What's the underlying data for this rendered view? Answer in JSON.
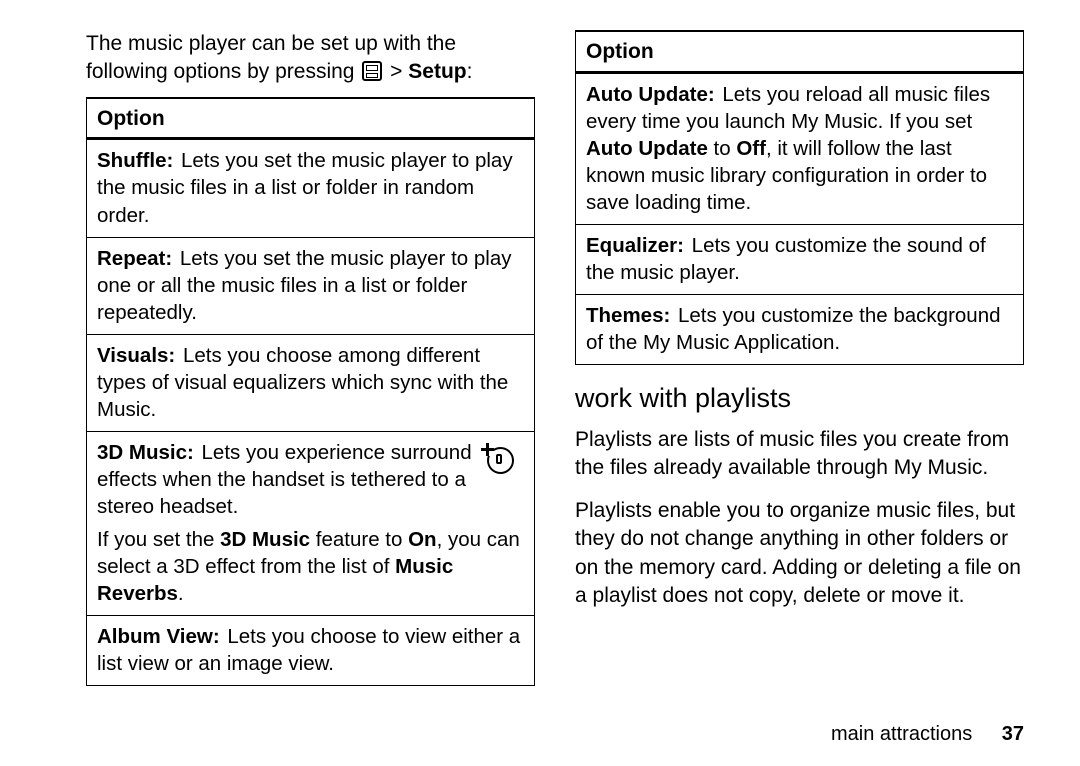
{
  "intro": {
    "line1": "The music player can be set up with the",
    "line2a": "following options by pressing ",
    "line2b": " > ",
    "setup": "Setup",
    "line2c": ":"
  },
  "option_header": "Option",
  "col1_rows": {
    "shuffle": {
      "name": "Shuffle:",
      "desc": " Lets you set the music player to play the music files in a list or folder in random order."
    },
    "repeat": {
      "name": "Repeat:",
      "desc": " Lets you set the music player to play one or all the music files in a list or folder repeatedly."
    },
    "visuals": {
      "name": "Visuals:",
      "desc": " Lets you choose among different types of visual equalizers which sync with the Music."
    },
    "threeD": {
      "name": "3D Music:",
      "desc": " Lets you experience surround effects when the handset is tethered to a stereo headset.",
      "extraA": "If you set the ",
      "extraB": "3D Music",
      "extraC": " feature to ",
      "extraD": "On",
      "extraE": ", you can select a 3D effect from the list of ",
      "extraF": "Music Reverbs",
      "extraG": "."
    },
    "album": {
      "name": "Album View:",
      "desc": " Lets you choose to view either a list view or an image view."
    }
  },
  "col2_rows": {
    "auto": {
      "name": "Auto Update:",
      "descA": " Lets you reload all music files every time you launch My Music. If you set ",
      "nameB": "Auto Update",
      "descB": " to ",
      "nameC": "Off",
      "descC": ", it will follow the last known music library configuration in order to save loading time."
    },
    "eq": {
      "name": "Equalizer:",
      "desc": " Lets you customize the sound of the music player."
    },
    "themes": {
      "name": "Themes:",
      "desc": " Lets you customize the background of the My Music Application."
    }
  },
  "section_head": "work with playlists",
  "playlists_p1": "Playlists are lists of music files you create from the files already available through My Music.",
  "playlists_p2": "Playlists enable you to organize music files, but they do not change anything in other folders or on the memory card. Adding or deleting a file on a playlist does not copy, delete or move it.",
  "footer": {
    "section": "main attractions",
    "page": "37"
  }
}
